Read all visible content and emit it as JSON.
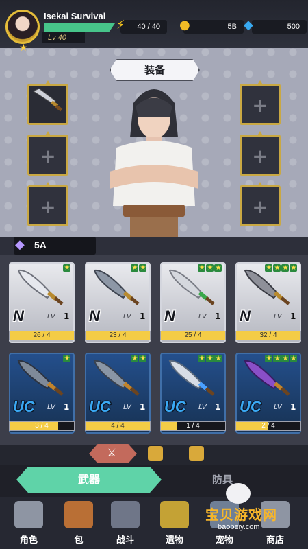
{
  "player": {
    "name": "Isekai Survival",
    "level": "Lv 40"
  },
  "resources": {
    "energy": "40 / 40",
    "gold": "5B",
    "gems": "500"
  },
  "equipment": {
    "title": "装备"
  },
  "power": {
    "value": "5A"
  },
  "cards": [
    {
      "rarity": "N",
      "lv": "LV",
      "level": "1",
      "stars": 1,
      "progress": "26 / 4",
      "fill": 1.0
    },
    {
      "rarity": "N",
      "lv": "LV",
      "level": "1",
      "stars": 2,
      "progress": "23 / 4",
      "fill": 1.0
    },
    {
      "rarity": "N",
      "lv": "LV",
      "level": "1",
      "stars": 3,
      "progress": "25 / 4",
      "fill": 1.0
    },
    {
      "rarity": "N",
      "lv": "LV",
      "level": "1",
      "stars": 4,
      "progress": "32 / 4",
      "fill": 1.0
    },
    {
      "rarity": "UC",
      "lv": "LV",
      "level": "1",
      "stars": 1,
      "progress": "3 / 4",
      "fill": 0.75
    },
    {
      "rarity": "UC",
      "lv": "LV",
      "level": "1",
      "stars": 2,
      "progress": "4 / 4",
      "fill": 1.0
    },
    {
      "rarity": "UC",
      "lv": "LV",
      "level": "1",
      "stars": 3,
      "progress": "1 / 4",
      "fill": 0.25
    },
    {
      "rarity": "UC",
      "lv": "LV",
      "level": "1",
      "stars": 4,
      "progress": "2 / 4",
      "fill": 0.5
    }
  ],
  "tabs": {
    "weapon": "武器",
    "armor": "防具"
  },
  "nav": [
    {
      "label": "角色",
      "icon": "helmet-icon"
    },
    {
      "label": "包",
      "icon": "backpack-icon"
    },
    {
      "label": "战斗",
      "icon": "gate-icon"
    },
    {
      "label": "遗物",
      "icon": "crown-icon"
    },
    {
      "label": "宠物",
      "icon": "pet-icon"
    },
    {
      "label": "商店",
      "icon": "shop-icon"
    }
  ],
  "watermark": {
    "title": "宝贝游戏网",
    "url": "baobeiy.com"
  },
  "colors": {
    "accent": "#5fd3a8",
    "gold": "#c9a843",
    "progress": "#f4cc46"
  }
}
